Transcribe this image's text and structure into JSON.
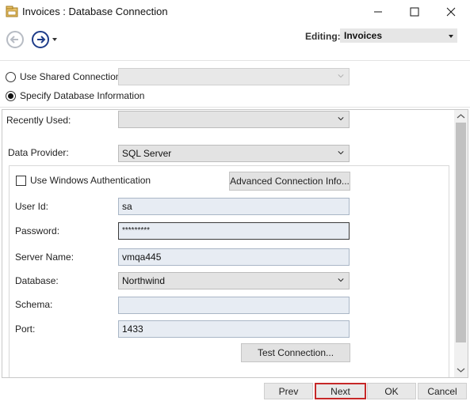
{
  "window": {
    "title": "Invoices : Database Connection"
  },
  "toolbar": {
    "editing_label": "Editing:",
    "editing_value": "Invoices"
  },
  "connection_mode": {
    "shared_label": "Use Shared Connection",
    "shared_value": "",
    "specify_label": "Specify Database Information",
    "selected": "specify"
  },
  "form": {
    "recently_used_label": "Recently Used:",
    "recently_used_value": "",
    "data_provider_label": "Data Provider:",
    "data_provider_value": "SQL Server",
    "windows_auth_label": "Use Windows Authentication",
    "windows_auth_checked": false,
    "advanced_button": "Advanced Connection Info...",
    "user_id_label": "User Id:",
    "user_id_value": "sa",
    "password_label": "Password:",
    "password_value": "*********",
    "server_name_label": "Server Name:",
    "server_name_value": "vmqa445",
    "database_label": "Database:",
    "database_value": "Northwind",
    "schema_label": "Schema:",
    "schema_value": "",
    "port_label": "Port:",
    "port_value": "1433",
    "test_button": "Test Connection..."
  },
  "buttons": {
    "prev": "Prev",
    "next": "Next",
    "ok": "OK",
    "cancel": "Cancel"
  },
  "icons": {
    "app": "database-icon",
    "back": "back-arrow-icon",
    "forward": "forward-arrow-icon",
    "minimize": "minimize-icon",
    "maximize": "maximize-icon",
    "close": "close-icon",
    "chevron": "chevron-down-icon"
  },
  "colors": {
    "accent_navy": "#1f3d8a",
    "field_fill": "#e7ecf3",
    "highlight_red": "#c62828"
  }
}
